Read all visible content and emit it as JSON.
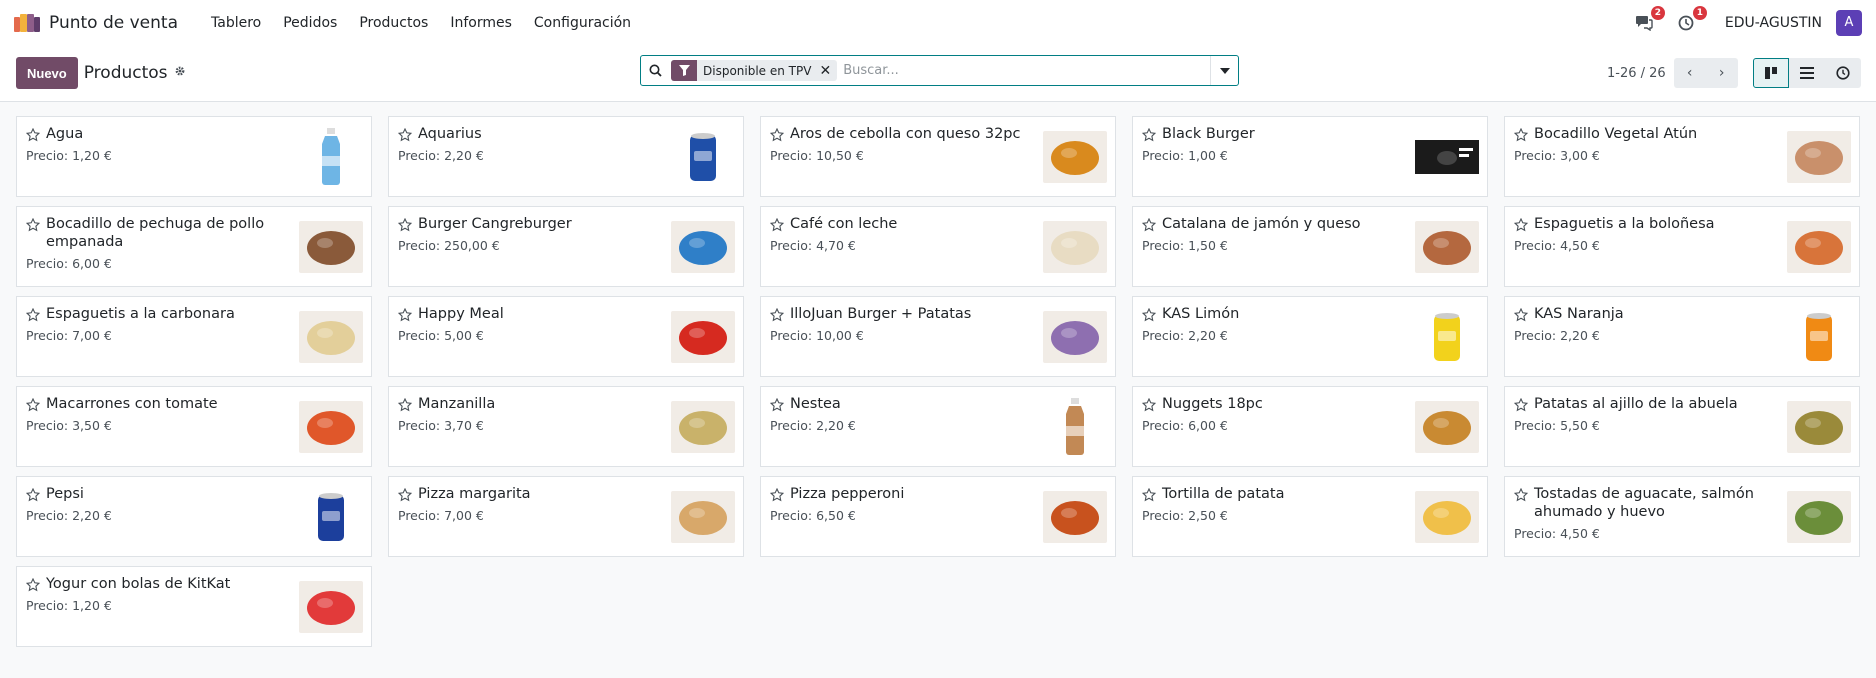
{
  "nav": {
    "app_name": "Punto de venta",
    "menu": [
      "Tablero",
      "Pedidos",
      "Productos",
      "Informes",
      "Configuración"
    ],
    "messages_badge": "2",
    "activities_badge": "1",
    "company": "EDU-AGUSTIN",
    "avatar_letter": "A"
  },
  "control": {
    "new_label": "Nuevo",
    "title": "Productos",
    "facet_label": "Disponible en TPV",
    "search_placeholder": "Buscar...",
    "pager_value": "1-26 / 26"
  },
  "price_label": "Precio:",
  "products": [
    {
      "name": "Agua",
      "price": "1,20 €",
      "icon": "water-bottle",
      "color": "#4aa3df"
    },
    {
      "name": "Aquarius",
      "price": "2,20 €",
      "icon": "can",
      "color": "#1f4fa8"
    },
    {
      "name": "Aros de cebolla con queso 32pc",
      "price": "10,50 €",
      "icon": "food",
      "color": "#d98a1e"
    },
    {
      "name": "Black Burger",
      "price": "1,00 €",
      "icon": "banner",
      "color": "#1b1b1b"
    },
    {
      "name": "Bocadillo Vegetal Atún",
      "price": "3,00 €",
      "icon": "food",
      "color": "#c9906b"
    },
    {
      "name": "Bocadillo de pechuga de pollo empanada",
      "price": "6,00 €",
      "icon": "food",
      "color": "#8a5a3a"
    },
    {
      "name": "Burger Cangreburger",
      "price": "250,00 €",
      "icon": "food",
      "color": "#2f7fc8"
    },
    {
      "name": "Café con leche",
      "price": "4,70 €",
      "icon": "food",
      "color": "#e8dcc3"
    },
    {
      "name": "Catalana de jamón y queso",
      "price": "1,50 €",
      "icon": "food",
      "color": "#b4683f"
    },
    {
      "name": "Espaguetis a la boloñesa",
      "price": "4,50 €",
      "icon": "food",
      "color": "#d8743a"
    },
    {
      "name": "Espaguetis a la carbonara",
      "price": "7,00 €",
      "icon": "food",
      "color": "#e3cf9a"
    },
    {
      "name": "Happy Meal",
      "price": "5,00 €",
      "icon": "food",
      "color": "#d62a20"
    },
    {
      "name": "IlloJuan Burger + Patatas",
      "price": "10,00 €",
      "icon": "food",
      "color": "#8e6fb0"
    },
    {
      "name": "KAS Limón",
      "price": "2,20 €",
      "icon": "can",
      "color": "#f2d21c"
    },
    {
      "name": "KAS Naranja",
      "price": "2,20 €",
      "icon": "can",
      "color": "#f08a14"
    },
    {
      "name": "Macarrones con tomate",
      "price": "3,50 €",
      "icon": "food",
      "color": "#e0572a"
    },
    {
      "name": "Manzanilla",
      "price": "3,70 €",
      "icon": "food",
      "color": "#c9b26a"
    },
    {
      "name": "Nestea",
      "price": "2,20 €",
      "icon": "water-bottle",
      "color": "#b36b2a"
    },
    {
      "name": "Nuggets 18pc",
      "price": "6,00 €",
      "icon": "food",
      "color": "#c98a32"
    },
    {
      "name": "Patatas al ajillo de la abuela",
      "price": "5,50 €",
      "icon": "food",
      "color": "#9a8a3a"
    },
    {
      "name": "Pepsi",
      "price": "2,20 €",
      "icon": "can",
      "color": "#1c3f9c"
    },
    {
      "name": "Pizza margarita",
      "price": "7,00 €",
      "icon": "food",
      "color": "#d8a86a"
    },
    {
      "name": "Pizza pepperoni",
      "price": "6,50 €",
      "icon": "food",
      "color": "#c8521e"
    },
    {
      "name": "Tortilla de patata",
      "price": "2,50 €",
      "icon": "food",
      "color": "#f0c04a"
    },
    {
      "name": "Tostadas de aguacate, salmón ahumado y huevo",
      "price": "4,50 €",
      "icon": "food",
      "color": "#6b8e3a"
    },
    {
      "name": "Yogur con bolas de KitKat",
      "price": "1,20 €",
      "icon": "food",
      "color": "#e23a3a"
    }
  ],
  "colors": {
    "brand": "#714b67",
    "accent": "#017e84",
    "badge": "#d9363e"
  }
}
